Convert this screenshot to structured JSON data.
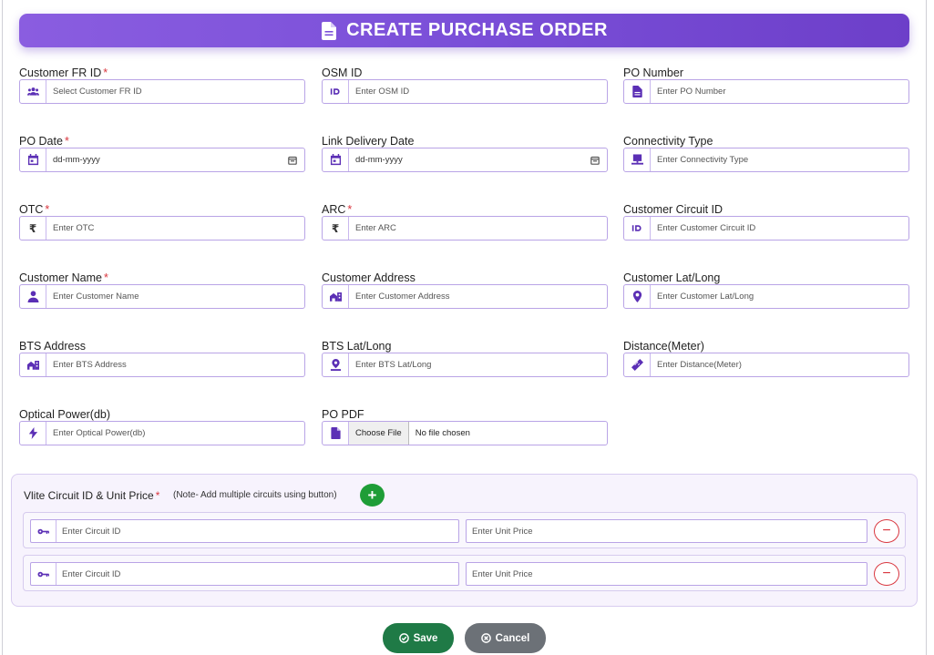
{
  "header": {
    "title": "CREATE PURCHASE ORDER",
    "icon": "document-icon"
  },
  "fields": {
    "customer_fr_id": {
      "label": "Customer FR ID",
      "required": "*",
      "placeholder": "Select Customer FR ID",
      "icon": "users-icon"
    },
    "osm_id": {
      "label": "OSM ID",
      "placeholder": "Enter OSM ID",
      "icon": "id-icon"
    },
    "po_number": {
      "label": "PO Number",
      "placeholder": "Enter PO Number",
      "icon": "document-icon"
    },
    "po_date": {
      "label": "PO Date",
      "required": "*",
      "value": "dd-mm-yyyy",
      "icon": "calendar-icon"
    },
    "link_delivery_date": {
      "label": "Link Delivery Date",
      "value": "dd-mm-yyyy",
      "icon": "calendar-icon"
    },
    "connectivity_type": {
      "label": "Connectivity Type",
      "placeholder": "Enter Connectivity Type",
      "icon": "monitor-icon"
    },
    "otc": {
      "label": "OTC",
      "required": "*",
      "placeholder": "Enter OTC",
      "icon": "rupee-icon"
    },
    "arc": {
      "label": "ARC",
      "required": "*",
      "placeholder": "Enter ARC",
      "icon": "rupee-icon"
    },
    "customer_circuit_id": {
      "label": "Customer Circuit ID",
      "placeholder": "Enter Customer Circuit ID",
      "icon": "id-icon"
    },
    "customer_name": {
      "label": "Customer Name",
      "required": "*",
      "placeholder": "Enter Customer Name",
      "icon": "user-icon"
    },
    "customer_address": {
      "label": "Customer Address",
      "placeholder": "Enter Customer Address",
      "icon": "building-icon"
    },
    "customer_latlong": {
      "label": "Customer Lat/Long",
      "placeholder": "Enter Customer Lat/Long",
      "icon": "map-pin-icon"
    },
    "bts_address": {
      "label": "BTS Address",
      "placeholder": "Enter BTS Address",
      "icon": "building-icon"
    },
    "bts_latlong": {
      "label": "BTS Lat/Long",
      "placeholder": "Enter BTS Lat/Long",
      "icon": "location-icon"
    },
    "distance": {
      "label": "Distance(Meter)",
      "placeholder": "Enter Distance(Meter)",
      "icon": "ruler-icon"
    },
    "optical_power": {
      "label": "Optical Power(db)",
      "placeholder": "Enter Optical Power(db)",
      "icon": "bolt-icon"
    },
    "po_pdf": {
      "label": "PO PDF",
      "button": "Choose File",
      "status": "No file chosen",
      "icon": "file-icon"
    }
  },
  "circuits": {
    "label": "Vlite Circuit ID & Unit Price",
    "required": "*",
    "note": "(Note- Add multiple circuits using button)",
    "add_symbol": "+",
    "remove_symbol": "−",
    "rows": [
      {
        "circuit_placeholder": "Enter Circuit ID",
        "price_placeholder": "Enter Unit Price"
      },
      {
        "circuit_placeholder": "Enter Circuit ID",
        "price_placeholder": "Enter Unit Price"
      }
    ]
  },
  "actions": {
    "save": "Save",
    "cancel": "Cancel"
  },
  "colors": {
    "accent": "#7a4fd8",
    "icon": "#5b2fb5",
    "save": "#1f7a46",
    "cancel": "#6c7177",
    "required": "#d9363e",
    "add": "#1f9d37"
  }
}
